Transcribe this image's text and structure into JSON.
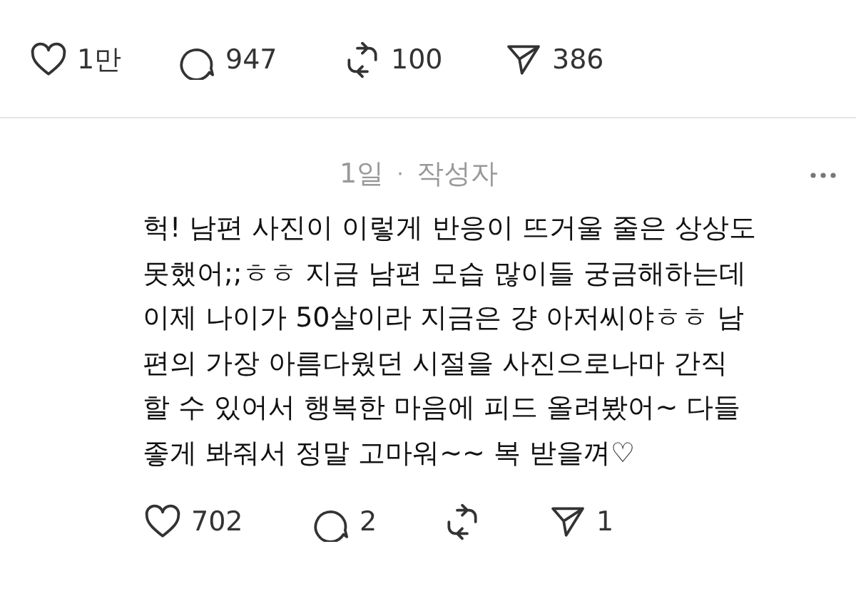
{
  "post_actions": [
    {
      "kind": "like",
      "count": "1만"
    },
    {
      "kind": "reply",
      "count": "947"
    },
    {
      "kind": "repost",
      "count": "100"
    },
    {
      "kind": "share",
      "count": "386"
    }
  ],
  "reply": {
    "time": "1일",
    "separator": "·",
    "author_tag": "작성자",
    "lines": [
      "헉! 남편 사진이 이렇게 반응이 뜨거울 줄은 상상도",
      "못했어;;ㅎㅎ 지금 남편 모습 많이들 궁금해하는데",
      "이제 나이가 50살이라 지금은 걍 아저씨야ㅎㅎ 남",
      "편의 가장 아름다웠던 시절을 사진으로나마 간직",
      "할 수 있어서 행복한 마음에 피드 올려봤어~ 다들",
      "좋게 봐줘서 정말 고마워~~ 복 받을껴♡"
    ],
    "actions": [
      {
        "kind": "like",
        "count": "702"
      },
      {
        "kind": "reply",
        "count": "2"
      },
      {
        "kind": "repost"
      },
      {
        "kind": "share",
        "count": "1"
      }
    ]
  }
}
